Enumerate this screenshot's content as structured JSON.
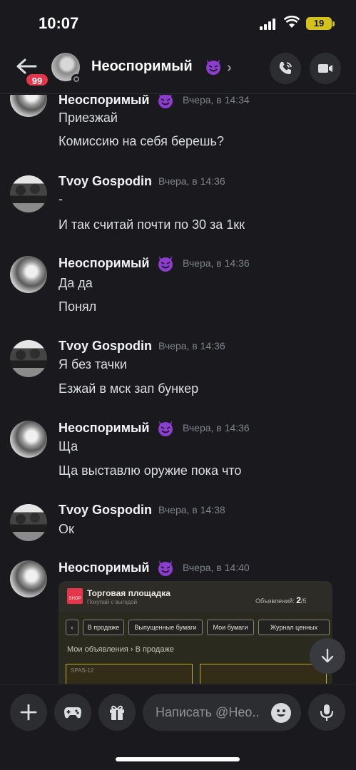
{
  "status_bar": {
    "time": "10:07",
    "battery": "19"
  },
  "header": {
    "back_badge": "99",
    "title": "Неоспоримый",
    "title_emoji": "smiling-imp-emoji",
    "chevron": "›"
  },
  "messages": [
    {
      "author": "Неоспоримый",
      "emoji": "smiling-imp-emoji",
      "time": "Вчера, в 14:34",
      "lines": [
        "Приезжай",
        "Комиссию на себя берешь?"
      ]
    },
    {
      "author": "Tvoy Gospodin",
      "time": "Вчера, в 14:36",
      "lines": [
        "-",
        "И так считай почти по 30 за 1кк"
      ]
    },
    {
      "author": "Неоспоримый",
      "emoji": "smiling-imp-emoji",
      "time": "Вчера, в 14:36",
      "lines": [
        "Да да",
        "Понял"
      ]
    },
    {
      "author": "Tvoy Gospodin",
      "time": "Вчера, в 14:36",
      "lines": [
        "Я без тачки",
        "Езжай в мск зап бункер"
      ]
    },
    {
      "author": "Неоспоримый",
      "emoji": "smiling-imp-emoji",
      "time": "Вчера, в 14:36",
      "lines": [
        "Ща",
        "Ща выставлю оружие пока что"
      ]
    },
    {
      "author": "Tvoy Gospodin",
      "time": "Вчера, в 14:38",
      "lines": [
        "Ок"
      ]
    },
    {
      "author": "Неоспоримый",
      "emoji": "smiling-imp-emoji",
      "time": "Вчера, в 14:40",
      "lines": []
    }
  ],
  "attachment": {
    "logo": "SHOP",
    "title": "Торговая площадка",
    "subtitle": "Покупай с выгодой",
    "count_label": "Объявлений:",
    "count_value": "2",
    "count_total": "/5",
    "tabs": [
      "В продаже",
      "Выпущенные бумаги",
      "Мои бумаги",
      "Журнал ценных"
    ],
    "breadcrumb": "Мои объявления › В продаже",
    "card_label": "SPAS-12"
  },
  "input": {
    "placeholder": "Написать @Нео.."
  },
  "colors": {
    "background": "#1a1a1e",
    "badge": "#e5354a",
    "emoji_purple": "#8b3dcf",
    "battery": "#d4c21a"
  }
}
